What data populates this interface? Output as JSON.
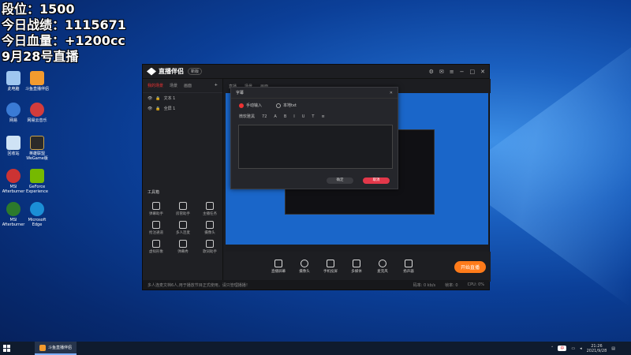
{
  "overlay": {
    "line1": "段位：1500",
    "line2": "今日战绩：1115671",
    "line3": "今日血量：+1200cc",
    "line4": "9月28号直播"
  },
  "desktop_icons": [
    {
      "label": "此电脑",
      "icon": "computer-icon",
      "color": "#9fc6f0"
    },
    {
      "label": "斗鱼直播伴侣",
      "icon": "live-icon",
      "color": "#f39b2e"
    },
    {
      "label": "网易",
      "icon": "netease-icon",
      "color": "#3a7bd5"
    },
    {
      "label": "网易云音乐",
      "icon": "music-icon",
      "color": "#d23c3c"
    },
    {
      "label": "回收站",
      "icon": "recycle-icon",
      "color": "#cfe3f5"
    },
    {
      "label": "英雄联盟WeGame版",
      "icon": "game-icon",
      "color": "#2a2a2a"
    },
    {
      "label": "MSI Afterburner",
      "icon": "afterburner-icon",
      "color": "#c33"
    },
    {
      "label": "GeForce Experience",
      "icon": "nvidia-icon",
      "color": "#76b900"
    },
    {
      "label": "MSI Afterburner",
      "icon": "afterburner-icon",
      "color": "#2c7a2c"
    },
    {
      "label": "Microsoft Edge",
      "icon": "edge-icon",
      "color": "#1b8fd6"
    }
  ],
  "app": {
    "title": "直播伴侣",
    "badge": "新版",
    "left_tabs": [
      "我的场景",
      "场景",
      "画面"
    ],
    "layers": [
      "文本 1",
      "全屏 1"
    ],
    "tools_header": "工具箱",
    "tools": [
      "弹幕助手",
      "房管助手",
      "主播任务",
      "抢注通道",
      "多人连麦",
      "摄像头",
      "虚拟形象",
      "弹幕秀",
      "歌词助手"
    ],
    "mid_tabs": [
      "直播",
      "场景",
      "画面"
    ],
    "bottom_buttons": [
      "直播屏幕",
      "摄像头",
      "手机投屏",
      "多媒体",
      "麦克风",
      "扬声器"
    ],
    "go_live": "开始直播",
    "status_text": "多人连麦文档6人,用于播放节目正式使用，请只管理播播！",
    "stats": [
      "码率: 0 kb/s",
      "帧率: 0",
      "CPU: 0%"
    ]
  },
  "dialog": {
    "title": "字幕",
    "close": "✕",
    "radio_manual": "手动输入",
    "radio_file": "本地txt",
    "font": "微软雅黑",
    "size": "72",
    "fmt_tools": [
      "B",
      "I",
      "U",
      "T",
      "≡"
    ],
    "ok": "确定",
    "cancel": "取消"
  },
  "taskbar": {
    "app_label": "斗鱼直播伴侣",
    "ime": "中",
    "time": "21:26",
    "date": "2021/9/28"
  }
}
